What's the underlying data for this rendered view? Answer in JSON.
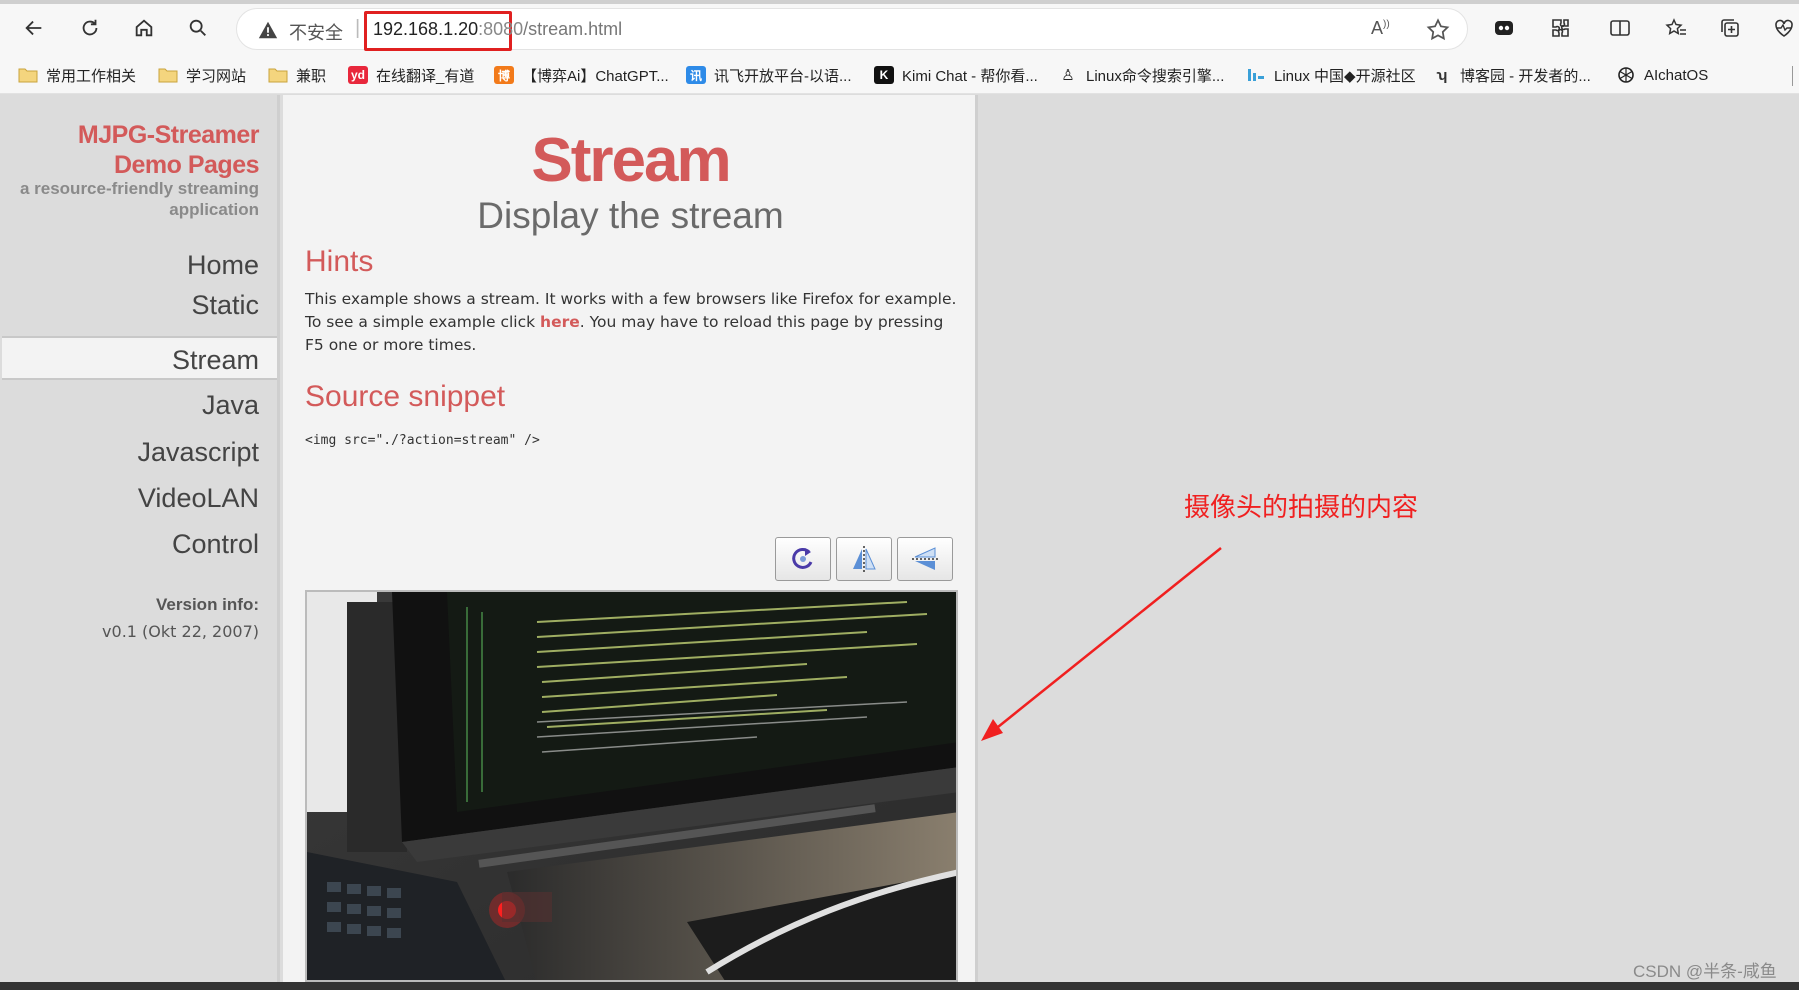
{
  "browser": {
    "security_label": "不安全",
    "url_host": "192.168.1.20",
    "url_port": ":8080",
    "url_path": "/stream.html"
  },
  "bookmarks": [
    {
      "label": "常用工作相关",
      "icon": "folder-icon"
    },
    {
      "label": "学习网站",
      "icon": "folder-icon"
    },
    {
      "label": "兼职",
      "icon": "folder-icon"
    },
    {
      "label": "在线翻译_有道",
      "icon": "youdao-icon",
      "badge": "yd",
      "color": "#e8283c"
    },
    {
      "label": "【博弈Ai】ChatGPT...",
      "icon": "boyi-icon",
      "badge": "博",
      "color": "#f27a1a"
    },
    {
      "label": "讯飞开放平台-以语...",
      "icon": "xunfei-icon",
      "badge": "讯",
      "color": "#2e8be8"
    },
    {
      "label": "Kimi Chat - 帮你看...",
      "icon": "kimi-icon",
      "badge": "K",
      "color": "#111111"
    },
    {
      "label": "Linux命令搜索引擎...",
      "icon": "penguin-icon"
    },
    {
      "label": "Linux 中国◆开源社区",
      "icon": "linuxcn-icon"
    },
    {
      "label": "博客园 - 开发者的...",
      "icon": "cnblogs-icon"
    },
    {
      "label": "AIchatOS",
      "icon": "openai-icon"
    }
  ],
  "sidebar": {
    "title_line1": "MJPG-Streamer",
    "title_line2": "Demo Pages",
    "subtitle": "a resource-friendly streaming application",
    "items": [
      {
        "label": "Home",
        "active": false
      },
      {
        "label": "Static",
        "active": false
      },
      {
        "label": "Stream",
        "active": true
      },
      {
        "label": "Java",
        "active": false
      },
      {
        "label": "Javascript",
        "active": false
      },
      {
        "label": "VideoLAN",
        "active": false
      },
      {
        "label": "Control",
        "active": false
      }
    ],
    "version_label": "Version info:",
    "version_value": "v0.1 (Okt 22, 2007)"
  },
  "main": {
    "title": "Stream",
    "subtitle": "Display the stream",
    "hints_heading": "Hints",
    "hints_before": "This example shows a stream. It works with a few browsers like Firefox for example. To see a simple example click ",
    "hints_link": "here",
    "hints_after": ". You may have to reload this page by pressing F5 one or more times.",
    "source_heading": "Source snippet",
    "code": "<img src=\"./?action=stream\" />",
    "buttons": [
      {
        "name": "rotate-button",
        "icon": "rotate-icon"
      },
      {
        "name": "flip-vertical-button",
        "icon": "flip-vertical-icon"
      },
      {
        "name": "flip-horizontal-button",
        "icon": "flip-horizontal-icon"
      }
    ]
  },
  "annotation": {
    "text": "摄像头的拍摄的内容",
    "color": "#f02020"
  },
  "watermark": "CSDN @半条-咸鱼",
  "colors": {
    "accent": "#d35a5a",
    "highlight": "#e02020"
  }
}
